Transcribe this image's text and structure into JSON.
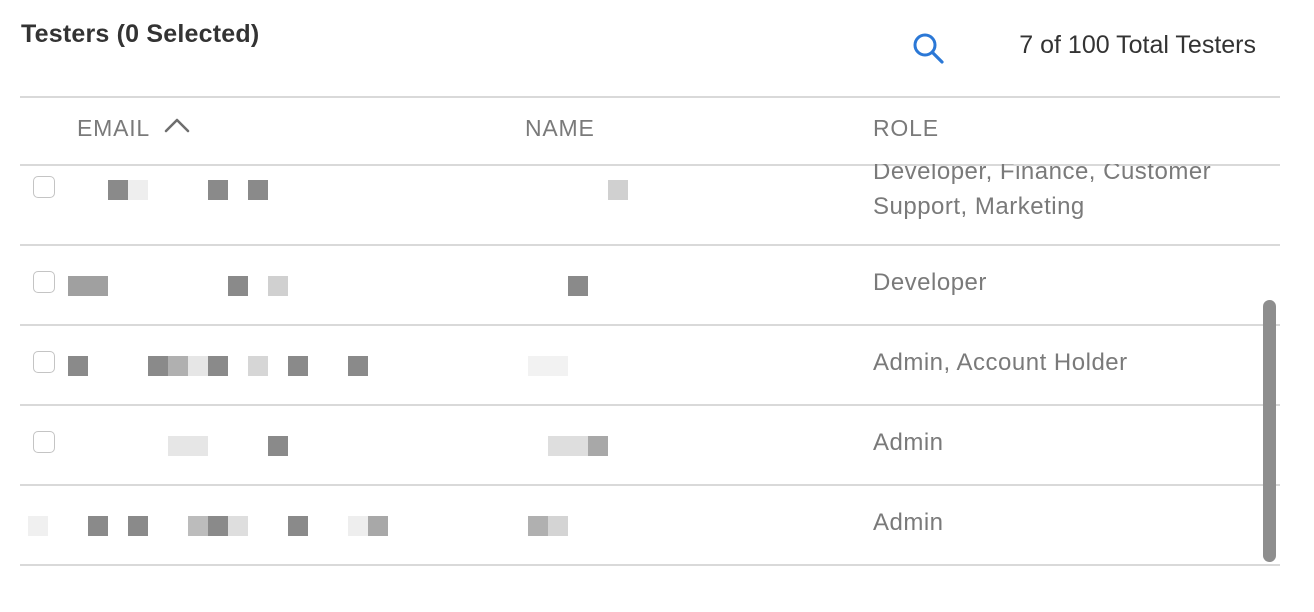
{
  "header": {
    "title": "Testers (0 Selected)",
    "total_label": "7 of 100 Total Testers",
    "search_icon": "search-icon"
  },
  "table": {
    "columns": [
      {
        "label": "EMAIL",
        "sorted": "ascending"
      },
      {
        "label": "NAME"
      },
      {
        "label": "ROLE"
      }
    ],
    "rows": [
      {
        "role": "Developer, Finance, Customer Support, Marketing",
        "email": "redacted",
        "name": "redacted"
      },
      {
        "role": "Developer",
        "email": "redacted",
        "name": "redacted"
      },
      {
        "role": "Admin, Account Holder",
        "email": "redacted",
        "name": "redacted"
      },
      {
        "role": "Admin",
        "email": "redacted",
        "name": "redacted"
      },
      {
        "role": "Admin",
        "email": "redacted",
        "name": "redacted"
      }
    ]
  },
  "colors": {
    "accent": "#2b78d6",
    "header_text": "#7a7a7a",
    "divider": "#d9d9d9",
    "scrollbar": "#8e8e8e"
  }
}
